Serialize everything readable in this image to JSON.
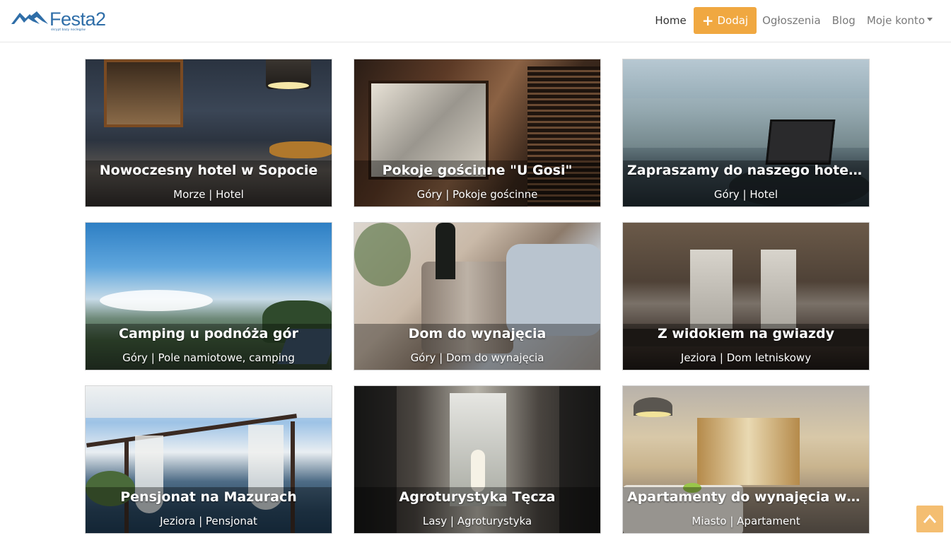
{
  "header": {
    "brand": "Festa",
    "brand_two": "2",
    "brand_tagline": "skrypt bazy noclegów",
    "nav": {
      "home": "Home",
      "add": "Dodaj",
      "listings": "Ogłoszenia",
      "blog": "Blog",
      "account": "Moje konto"
    }
  },
  "listings": [
    {
      "title": "Nowoczesny hotel w Sopocie",
      "meta": "Morze | Hotel"
    },
    {
      "title": "Pokoje gościnne \"U Gosi\"",
      "meta": "Góry | Pokoje gościnne"
    },
    {
      "title": "Zapraszamy do naszego hotelu!",
      "meta": "Góry | Hotel"
    },
    {
      "title": "Camping u podnóża gór",
      "meta": "Góry | Pole namiotowe, camping"
    },
    {
      "title": "Dom do wynajęcia",
      "meta": "Góry | Dom do wynajęcia"
    },
    {
      "title": "Z widokiem na gwiazdy",
      "meta": "Jeziora | Dom letniskowy"
    },
    {
      "title": "Pensjonat na Mazurach",
      "meta": "Jeziora | Pensjonat"
    },
    {
      "title": "Agroturystyka Tęcza",
      "meta": "Lasy | Agroturystyka"
    },
    {
      "title": "Apartamenty do wynajęcia w Warszawie",
      "meta": "Miasto | Apartament"
    }
  ],
  "colors": {
    "accent": "#f0a841",
    "brand": "#2f6ea8"
  }
}
